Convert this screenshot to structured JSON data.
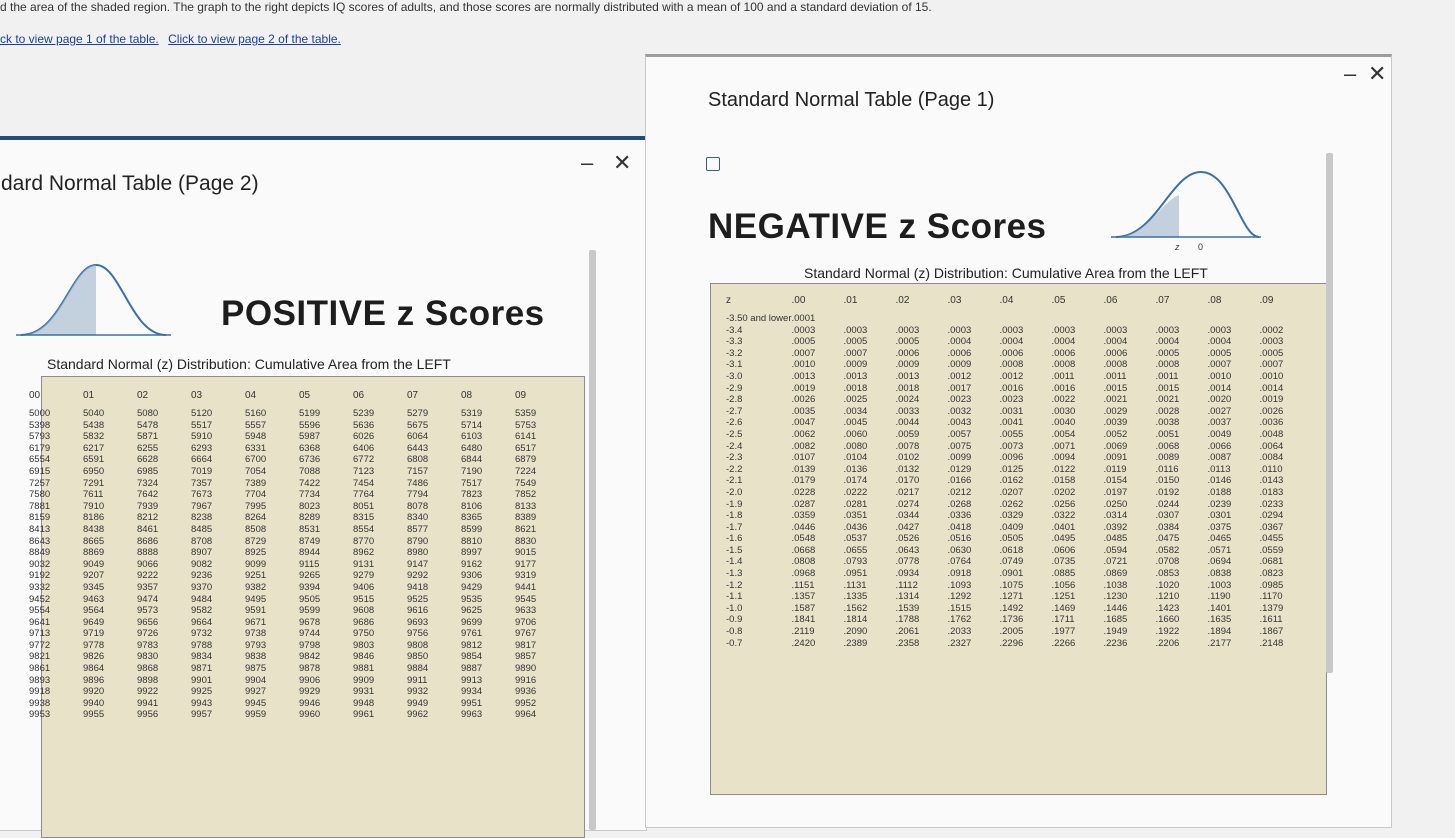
{
  "instructions": "d the area of the shaded region. The graph to the right depicts IQ scores of adults, and those scores are normally distributed with a mean of 100 and a standard deviation of 15.",
  "links": {
    "page1": "ck to view page 1 of the table.",
    "page2": "Click to view page 2 of the table."
  },
  "page2": {
    "window_title": "dard Normal Table (Page 2)",
    "heading": "POSITIVE z Scores",
    "subheading": "Standard Normal (z) Distribution: Cumulative Area from the LEFT",
    "curve_labels": [
      "0",
      "z"
    ],
    "columns": [
      "00",
      "01",
      "02",
      "03",
      "04",
      "05",
      "06",
      "07",
      "08",
      "09"
    ],
    "rows": [
      [
        "5000",
        "5040",
        "5080",
        "5120",
        "5160",
        "5199",
        "5239",
        "5279",
        "5319",
        "5359"
      ],
      [
        "5398",
        "5438",
        "5478",
        "5517",
        "5557",
        "5596",
        "5636",
        "5675",
        "5714",
        "5753"
      ],
      [
        "5793",
        "5832",
        "5871",
        "5910",
        "5948",
        "5987",
        "6026",
        "6064",
        "6103",
        "6141"
      ],
      [
        "6179",
        "6217",
        "6255",
        "6293",
        "6331",
        "6368",
        "6406",
        "6443",
        "6480",
        "6517"
      ],
      [
        "6554",
        "6591",
        "6628",
        "6664",
        "6700",
        "6736",
        "6772",
        "6808",
        "6844",
        "6879"
      ],
      [
        "6915",
        "6950",
        "6985",
        "7019",
        "7054",
        "7088",
        "7123",
        "7157",
        "7190",
        "7224"
      ],
      [
        "7257",
        "7291",
        "7324",
        "7357",
        "7389",
        "7422",
        "7454",
        "7486",
        "7517",
        "7549"
      ],
      [
        "7580",
        "7611",
        "7642",
        "7673",
        "7704",
        "7734",
        "7764",
        "7794",
        "7823",
        "7852"
      ],
      [
        "7881",
        "7910",
        "7939",
        "7967",
        "7995",
        "8023",
        "8051",
        "8078",
        "8106",
        "8133"
      ],
      [
        "8159",
        "8186",
        "8212",
        "8238",
        "8264",
        "8289",
        "8315",
        "8340",
        "8365",
        "8389"
      ],
      [
        "8413",
        "8438",
        "8461",
        "8485",
        "8508",
        "8531",
        "8554",
        "8577",
        "8599",
        "8621"
      ],
      [
        "8643",
        "8665",
        "8686",
        "8708",
        "8729",
        "8749",
        "8770",
        "8790",
        "8810",
        "8830"
      ],
      [
        "8849",
        "8869",
        "8888",
        "8907",
        "8925",
        "8944",
        "8962",
        "8980",
        "8997",
        "9015"
      ],
      [
        "9032",
        "9049",
        "9066",
        "9082",
        "9099",
        "9115",
        "9131",
        "9147",
        "9162",
        "9177"
      ],
      [
        "9192",
        "9207",
        "9222",
        "9236",
        "9251",
        "9265",
        "9279",
        "9292",
        "9306",
        "9319"
      ],
      [
        "9332",
        "9345",
        "9357",
        "9370",
        "9382",
        "9394",
        "9406",
        "9418",
        "9429",
        "9441"
      ],
      [
        "9452",
        "9463",
        "9474",
        "9484",
        "9495",
        "9505",
        "9515",
        "9525",
        "9535",
        "9545"
      ],
      [
        "9554",
        "9564",
        "9573",
        "9582",
        "9591",
        "9599",
        "9608",
        "9616",
        "9625",
        "9633"
      ],
      [
        "9641",
        "9649",
        "9656",
        "9664",
        "9671",
        "9678",
        "9686",
        "9693",
        "9699",
        "9706"
      ],
      [
        "9713",
        "9719",
        "9726",
        "9732",
        "9738",
        "9744",
        "9750",
        "9756",
        "9761",
        "9767"
      ],
      [
        "9772",
        "9778",
        "9783",
        "9788",
        "9793",
        "9798",
        "9803",
        "9808",
        "9812",
        "9817"
      ],
      [
        "9821",
        "9826",
        "9830",
        "9834",
        "9838",
        "9842",
        "9846",
        "9850",
        "9854",
        "9857"
      ],
      [
        "9861",
        "9864",
        "9868",
        "9871",
        "9875",
        "9878",
        "9881",
        "9884",
        "9887",
        "9890"
      ],
      [
        "9893",
        "9896",
        "9898",
        "9901",
        "9904",
        "9906",
        "9909",
        "9911",
        "9913",
        "9916"
      ],
      [
        "9918",
        "9920",
        "9922",
        "9925",
        "9927",
        "9929",
        "9931",
        "9932",
        "9934",
        "9936"
      ],
      [
        "9938",
        "9940",
        "9941",
        "9943",
        "9945",
        "9946",
        "9948",
        "9949",
        "9951",
        "9952"
      ],
      [
        "9953",
        "9955",
        "9956",
        "9957",
        "9959",
        "9960",
        "9961",
        "9962",
        "9963",
        "9964"
      ]
    ]
  },
  "page1": {
    "window_title": "Standard Normal Table (Page 1)",
    "heading": "NEGATIVE z Scores",
    "subheading": "Standard Normal (z) Distribution: Cumulative Area from the LEFT",
    "curve_labels": [
      "z",
      "0"
    ],
    "columns": [
      "z",
      ".00",
      ".01",
      ".02",
      ".03",
      ".04",
      ".05",
      ".06",
      ".07",
      ".08",
      ".09"
    ],
    "rows": [
      [
        "-3.50 and lower",
        ".0001",
        "",
        "",
        "",
        "",
        "",
        "",
        "",
        "",
        ""
      ],
      [
        "-3.4",
        ".0003",
        ".0003",
        ".0003",
        ".0003",
        ".0003",
        ".0003",
        ".0003",
        ".0003",
        ".0003",
        ".0002"
      ],
      [
        "-3.3",
        ".0005",
        ".0005",
        ".0005",
        ".0004",
        ".0004",
        ".0004",
        ".0004",
        ".0004",
        ".0004",
        ".0003"
      ],
      [
        "-3.2",
        ".0007",
        ".0007",
        ".0006",
        ".0006",
        ".0006",
        ".0006",
        ".0006",
        ".0005",
        ".0005",
        ".0005"
      ],
      [
        "-3.1",
        ".0010",
        ".0009",
        ".0009",
        ".0009",
        ".0008",
        ".0008",
        ".0008",
        ".0008",
        ".0007",
        ".0007"
      ],
      [
        "-3.0",
        ".0013",
        ".0013",
        ".0013",
        ".0012",
        ".0012",
        ".0011",
        ".0011",
        ".0011",
        ".0010",
        ".0010"
      ],
      [
        "-2.9",
        ".0019",
        ".0018",
        ".0018",
        ".0017",
        ".0016",
        ".0016",
        ".0015",
        ".0015",
        ".0014",
        ".0014"
      ],
      [
        "-2.8",
        ".0026",
        ".0025",
        ".0024",
        ".0023",
        ".0023",
        ".0022",
        ".0021",
        ".0021",
        ".0020",
        ".0019"
      ],
      [
        "-2.7",
        ".0035",
        ".0034",
        ".0033",
        ".0032",
        ".0031",
        ".0030",
        ".0029",
        ".0028",
        ".0027",
        ".0026"
      ],
      [
        "-2.6",
        ".0047",
        ".0045",
        ".0044",
        ".0043",
        ".0041",
        ".0040",
        ".0039",
        ".0038",
        ".0037",
        ".0036"
      ],
      [
        "-2.5",
        ".0062",
        ".0060",
        ".0059",
        ".0057",
        ".0055",
        ".0054",
        ".0052",
        ".0051",
        ".0049",
        ".0048"
      ],
      [
        "-2.4",
        ".0082",
        ".0080",
        ".0078",
        ".0075",
        ".0073",
        ".0071",
        ".0069",
        ".0068",
        ".0066",
        ".0064"
      ],
      [
        "-2.3",
        ".0107",
        ".0104",
        ".0102",
        ".0099",
        ".0096",
        ".0094",
        ".0091",
        ".0089",
        ".0087",
        ".0084"
      ],
      [
        "-2.2",
        ".0139",
        ".0136",
        ".0132",
        ".0129",
        ".0125",
        ".0122",
        ".0119",
        ".0116",
        ".0113",
        ".0110"
      ],
      [
        "-2.1",
        ".0179",
        ".0174",
        ".0170",
        ".0166",
        ".0162",
        ".0158",
        ".0154",
        ".0150",
        ".0146",
        ".0143"
      ],
      [
        "-2.0",
        ".0228",
        ".0222",
        ".0217",
        ".0212",
        ".0207",
        ".0202",
        ".0197",
        ".0192",
        ".0188",
        ".0183"
      ],
      [
        "-1.9",
        ".0287",
        ".0281",
        ".0274",
        ".0268",
        ".0262",
        ".0256",
        ".0250",
        ".0244",
        ".0239",
        ".0233"
      ],
      [
        "-1.8",
        ".0359",
        ".0351",
        ".0344",
        ".0336",
        ".0329",
        ".0322",
        ".0314",
        ".0307",
        ".0301",
        ".0294"
      ],
      [
        "-1.7",
        ".0446",
        ".0436",
        ".0427",
        ".0418",
        ".0409",
        ".0401",
        ".0392",
        ".0384",
        ".0375",
        ".0367"
      ],
      [
        "-1.6",
        ".0548",
        ".0537",
        ".0526",
        ".0516",
        ".0505",
        ".0495",
        ".0485",
        ".0475",
        ".0465",
        ".0455"
      ],
      [
        "-1.5",
        ".0668",
        ".0655",
        ".0643",
        ".0630",
        ".0618",
        ".0606",
        ".0594",
        ".0582",
        ".0571",
        ".0559"
      ],
      [
        "-1.4",
        ".0808",
        ".0793",
        ".0778",
        ".0764",
        ".0749",
        ".0735",
        ".0721",
        ".0708",
        ".0694",
        ".0681"
      ],
      [
        "-1.3",
        ".0968",
        ".0951",
        ".0934",
        ".0918",
        ".0901",
        ".0885",
        ".0869",
        ".0853",
        ".0838",
        ".0823"
      ],
      [
        "-1.2",
        ".1151",
        ".1131",
        ".1112",
        ".1093",
        ".1075",
        ".1056",
        ".1038",
        ".1020",
        ".1003",
        ".0985"
      ],
      [
        "-1.1",
        ".1357",
        ".1335",
        ".1314",
        ".1292",
        ".1271",
        ".1251",
        ".1230",
        ".1210",
        ".1190",
        ".1170"
      ],
      [
        "-1.0",
        ".1587",
        ".1562",
        ".1539",
        ".1515",
        ".1492",
        ".1469",
        ".1446",
        ".1423",
        ".1401",
        ".1379"
      ],
      [
        "-0.9",
        ".1841",
        ".1814",
        ".1788",
        ".1762",
        ".1736",
        ".1711",
        ".1685",
        ".1660",
        ".1635",
        ".1611"
      ],
      [
        "-0.8",
        ".2119",
        ".2090",
        ".2061",
        ".2033",
        ".2005",
        ".1977",
        ".1949",
        ".1922",
        ".1894",
        ".1867"
      ],
      [
        "-0.7",
        ".2420",
        ".2389",
        ".2358",
        ".2327",
        ".2296",
        ".2266",
        ".2236",
        ".2206",
        ".2177",
        ".2148"
      ]
    ]
  },
  "controls": {
    "minimize": "–",
    "close": "✕"
  },
  "icons": {
    "curve": "bell-curve-icon",
    "page": "document-icon"
  }
}
